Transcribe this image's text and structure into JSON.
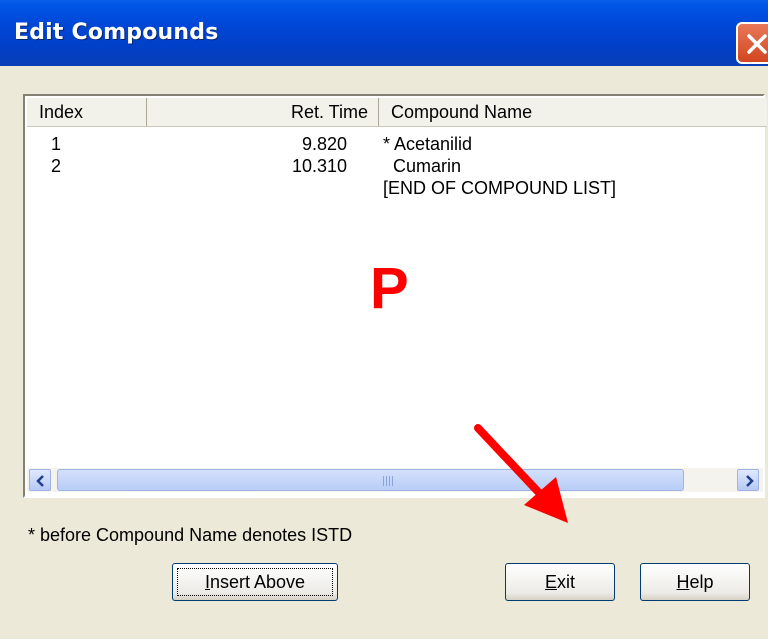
{
  "window": {
    "title": "Edit Compounds"
  },
  "list": {
    "headers": {
      "index": "Index",
      "ret_time": "Ret. Time",
      "name": "Compound Name"
    },
    "rows": [
      {
        "index": "1",
        "ret_time": "9.820",
        "name": "* Acetanilid"
      },
      {
        "index": "2",
        "ret_time": "10.310",
        "name": "  Cumarin"
      },
      {
        "index": "",
        "ret_time": "",
        "name": "[END OF COMPOUND LIST]"
      }
    ]
  },
  "note": "* before Compound Name denotes ISTD",
  "buttons": {
    "insert_above": {
      "access_key": "I",
      "rest": "nsert Above"
    },
    "exit": {
      "access_key": "E",
      "rest": "xit"
    },
    "help": {
      "access_key": "H",
      "rest": "elp"
    }
  },
  "annotation": {
    "marker_letter": "P",
    "color": "#ff0000"
  },
  "colors": {
    "titlebar": "#0046d6",
    "dialog_bg": "#ece9d8"
  }
}
